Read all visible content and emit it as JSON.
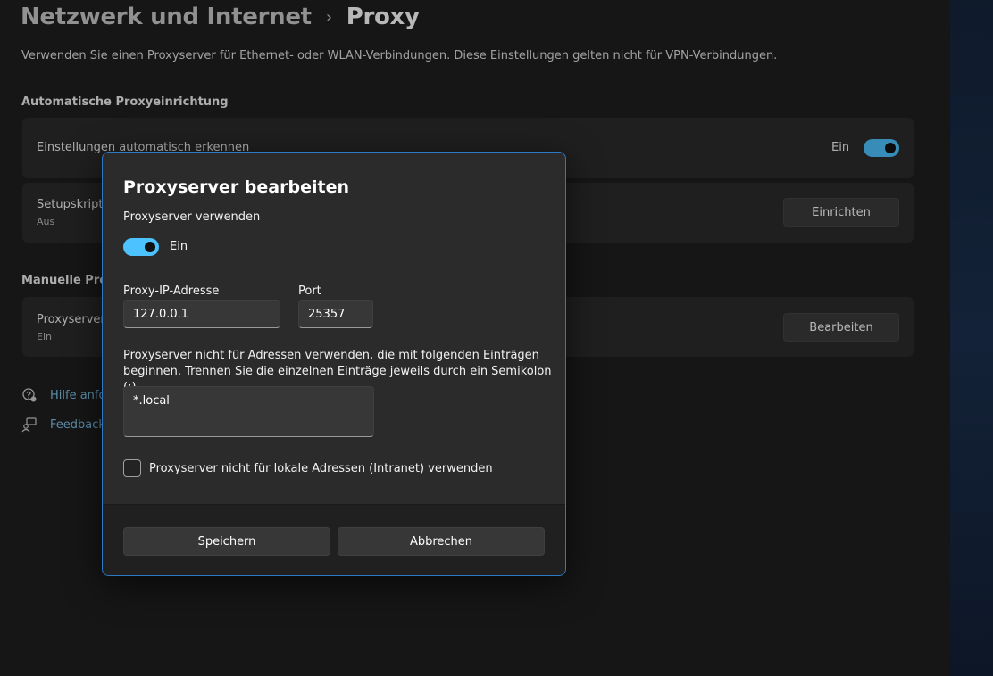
{
  "header": {
    "parent": "Netzwerk und Internet",
    "separator": "›",
    "current": "Proxy"
  },
  "intro": "Verwenden Sie einen Proxyserver für Ethernet- oder WLAN-Verbindungen. Diese Einstellungen gelten nicht für VPN-Verbindungen.",
  "auto_section": {
    "title": "Automatische Proxyeinrichtung",
    "detect": {
      "label": "Einstellungen automatisch erkennen",
      "state": "Ein",
      "on": true
    },
    "script": {
      "label": "Setupskript verwenden",
      "sub": "Aus",
      "button": "Einrichten"
    }
  },
  "manual_section": {
    "title": "Manuelle Proxyeinrichtung",
    "proxy": {
      "label": "Proxyserver verwenden",
      "sub": "Ein",
      "button": "Bearbeiten"
    }
  },
  "links": [
    {
      "icon": "help-icon",
      "label": "Hilfe anfordern"
    },
    {
      "icon": "feedback-icon",
      "label": "Feedback senden"
    }
  ],
  "dialog": {
    "title": "Proxyserver bearbeiten",
    "use_proxy_label": "Proxyserver verwenden",
    "toggle_state": "Ein",
    "toggle_on": true,
    "ip_label": "Proxy-IP-Adresse",
    "ip_value": "127.0.0.1",
    "port_label": "Port",
    "port_value": "25357",
    "exceptions_desc": "Proxyserver nicht für Adressen verwenden, die mit folgenden Einträgen beginnen. Trennen Sie die einzelnen Einträge jeweils durch ein Semikolon (;).",
    "exceptions_value": "*.local",
    "local_checkbox_label": "Proxyserver nicht für lokale Adressen (Intranet) verwenden",
    "local_checked": false,
    "save_label": "Speichern",
    "cancel_label": "Abbrechen"
  },
  "colors": {
    "accent": "#4cc2ff",
    "dialog_border": "#2f78c4",
    "link": "#7fc3e8"
  }
}
